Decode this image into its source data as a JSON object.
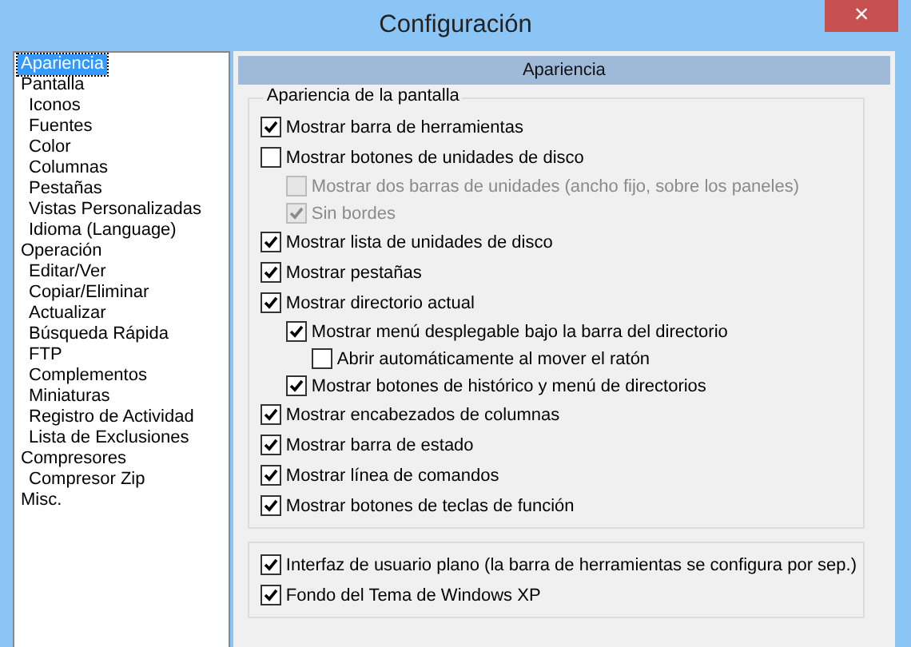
{
  "window": {
    "title": "Configuración",
    "close": "×"
  },
  "sidebar": {
    "items": [
      {
        "label": "Apariencia",
        "selected": true
      },
      {
        "label": "Pantalla",
        "selected": false,
        "children": [
          {
            "label": "Iconos",
            "selected": false
          },
          {
            "label": "Fuentes",
            "selected": false
          },
          {
            "label": "Color",
            "selected": false
          },
          {
            "label": "Columnas",
            "selected": false
          },
          {
            "label": "Pestañas",
            "selected": false
          },
          {
            "label": "Vistas Personalizadas",
            "selected": false
          },
          {
            "label": "Idioma (Language)",
            "selected": false
          }
        ]
      },
      {
        "label": "Operación",
        "selected": false,
        "children": [
          {
            "label": "Editar/Ver",
            "selected": false
          },
          {
            "label": "Copiar/Eliminar",
            "selected": false
          },
          {
            "label": "Actualizar",
            "selected": false
          },
          {
            "label": "Búsqueda Rápida",
            "selected": false
          },
          {
            "label": "FTP",
            "selected": false
          },
          {
            "label": "Complementos",
            "selected": false
          },
          {
            "label": "Miniaturas",
            "selected": false
          },
          {
            "label": "Registro de Actividad",
            "selected": false
          },
          {
            "label": "Lista de Exclusiones",
            "selected": false
          }
        ]
      },
      {
        "label": "Compresores",
        "selected": false,
        "children": [
          {
            "label": "Compresor Zip",
            "selected": false
          }
        ]
      },
      {
        "label": "Misc.",
        "selected": false
      }
    ]
  },
  "panel": {
    "header": "Apariencia",
    "groups": [
      {
        "title": "Apariencia de la pantalla",
        "options": [
          {
            "label": "Mostrar barra de herramientas",
            "checked": true,
            "disabled": false
          },
          {
            "label": "Mostrar botones de unidades de disco",
            "checked": false,
            "disabled": false,
            "children": [
              {
                "label": "Mostrar dos barras de unidades (ancho fijo, sobre los paneles)",
                "checked": false,
                "disabled": true
              },
              {
                "label": "Sin bordes",
                "checked": true,
                "disabled": true
              }
            ]
          },
          {
            "label": "Mostrar lista de unidades de disco",
            "checked": true,
            "disabled": false
          },
          {
            "label": "Mostrar pestañas",
            "checked": true,
            "disabled": false
          },
          {
            "label": "Mostrar directorio actual",
            "checked": true,
            "disabled": false,
            "children": [
              {
                "label": "Mostrar menú desplegable bajo la barra del directorio",
                "checked": true,
                "disabled": false,
                "children": [
                  {
                    "label": "Abrir automáticamente al mover el ratón",
                    "checked": false,
                    "disabled": false
                  }
                ]
              },
              {
                "label": "Mostrar botones de histórico y menú de directorios",
                "checked": true,
                "disabled": false
              }
            ]
          },
          {
            "label": "Mostrar encabezados de columnas",
            "checked": true,
            "disabled": false
          },
          {
            "label": "Mostrar barra de estado",
            "checked": true,
            "disabled": false
          },
          {
            "label": "Mostrar línea de comandos",
            "checked": true,
            "disabled": false
          },
          {
            "label": "Mostrar botones de teclas de función",
            "checked": true,
            "disabled": false
          }
        ]
      },
      {
        "options": [
          {
            "label": "Interfaz de usuario plano (la barra de herramientas se configura por sep.)",
            "checked": true,
            "disabled": false
          },
          {
            "label": "Fondo del Tema de Windows XP",
            "checked": true,
            "disabled": false
          }
        ]
      }
    ]
  }
}
